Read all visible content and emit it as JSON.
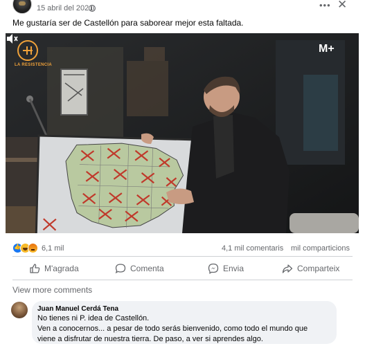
{
  "header": {
    "date": "15 abril del 2021",
    "more_label": "•••",
    "close_label": "✕"
  },
  "post": {
    "text": "Me gustaría ser de Castellón para saborear mejor esta faltada."
  },
  "video": {
    "show_logo_text": "LA RESISTENCIA",
    "channel_logo": "M+"
  },
  "stats": {
    "reaction_count": "6,1 mil",
    "comments": "4,1 mil comentaris",
    "shares": "mil comparticions",
    "reactions": [
      "like-icon",
      "haha-icon",
      "angry-icon"
    ]
  },
  "actions": {
    "like": "M'agrada",
    "comment": "Comenta",
    "send": "Envia",
    "share": "Comparteix"
  },
  "comments_section": {
    "view_more": "View more comments",
    "comment": {
      "author": "Juan Manuel Cerdá Tena",
      "lines": [
        "No tienes ni P. idea de Castellón.",
        "Ven a conocernos... a pesar de todo serás bienvenido, como todo el mundo que",
        "viene a disfrutar de nuestra tierra. De paso, a ver si aprendes algo."
      ]
    }
  },
  "colors": {
    "accent": "#1877f2",
    "muted_text": "#65676b",
    "comment_bubble": "#f0f2f5",
    "logo_orange": "#f0a23a"
  }
}
